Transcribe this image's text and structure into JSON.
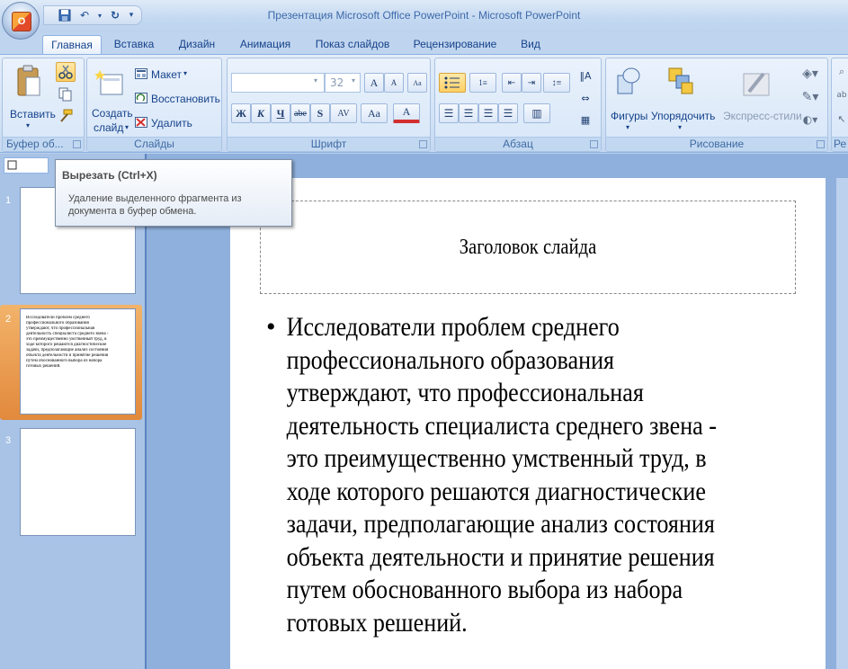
{
  "window": {
    "title": "Презентация Microsoft Office PowerPoint - Microsoft PowerPoint"
  },
  "tabs": [
    "Главная",
    "Вставка",
    "Дизайн",
    "Анимация",
    "Показ слайдов",
    "Рецензирование",
    "Вид"
  ],
  "ribbon": {
    "clipboard": {
      "group": "Буфер об...",
      "paste": "Вставить"
    },
    "slides": {
      "group": "Слайды",
      "new_slide_1": "Создать",
      "new_slide_2": "слайд",
      "layout": "Макет",
      "reset": "Восстановить",
      "delete": "Удалить"
    },
    "font": {
      "group": "Шрифт",
      "font_name": "",
      "font_size": "32",
      "bold": "Ж",
      "italic": "К",
      "underline": "Ч",
      "strike": "abe",
      "shadow": "S",
      "spacing": "AV",
      "case": "Aa",
      "color": "A",
      "grow": "A",
      "shrink": "A"
    },
    "paragraph": {
      "group": "Абзац"
    },
    "drawing": {
      "group": "Рисование",
      "shapes": "Фигуры",
      "arrange": "Упорядочить",
      "quick_styles": "Экспресс-стили"
    },
    "editing": {
      "group": "Ре"
    }
  },
  "tooltip": {
    "title": "Вырезать (Ctrl+X)",
    "desc_1": "Удаление выделенного фрагмента из",
    "desc_2": "документа в буфер обмена."
  },
  "slides_pane": {
    "numbers": [
      "1",
      "2",
      "3"
    ],
    "thumb2_lines": [
      "Исследователи проблем среднего",
      "профессионального образования",
      "утверждают, что профессиональная",
      "деятельность специалиста среднего звена -",
      "это преимущественно умственный труд, в",
      "ходе которого решаются диагностические",
      "задачи, предполагающие анализ состояния",
      "объекта деятельности и принятие решения",
      "путем обоснованного выбора из набора",
      "готовых решений."
    ]
  },
  "slide": {
    "title_placeholder": "Заголовок слайда",
    "bullet": "•",
    "body_lines": [
      "Исследователи проблем среднего",
      "профессионального образования",
      "утверждают, что профессиональная",
      "деятельность специалиста среднего звена -",
      "это преимущественно умственный труд, в",
      "ходе которого решаются диагностические",
      "задачи, предполагающие анализ состояния",
      "объекта деятельности и принятие решения",
      "путем обоснованного выбора из набора",
      "готовых решений."
    ]
  }
}
